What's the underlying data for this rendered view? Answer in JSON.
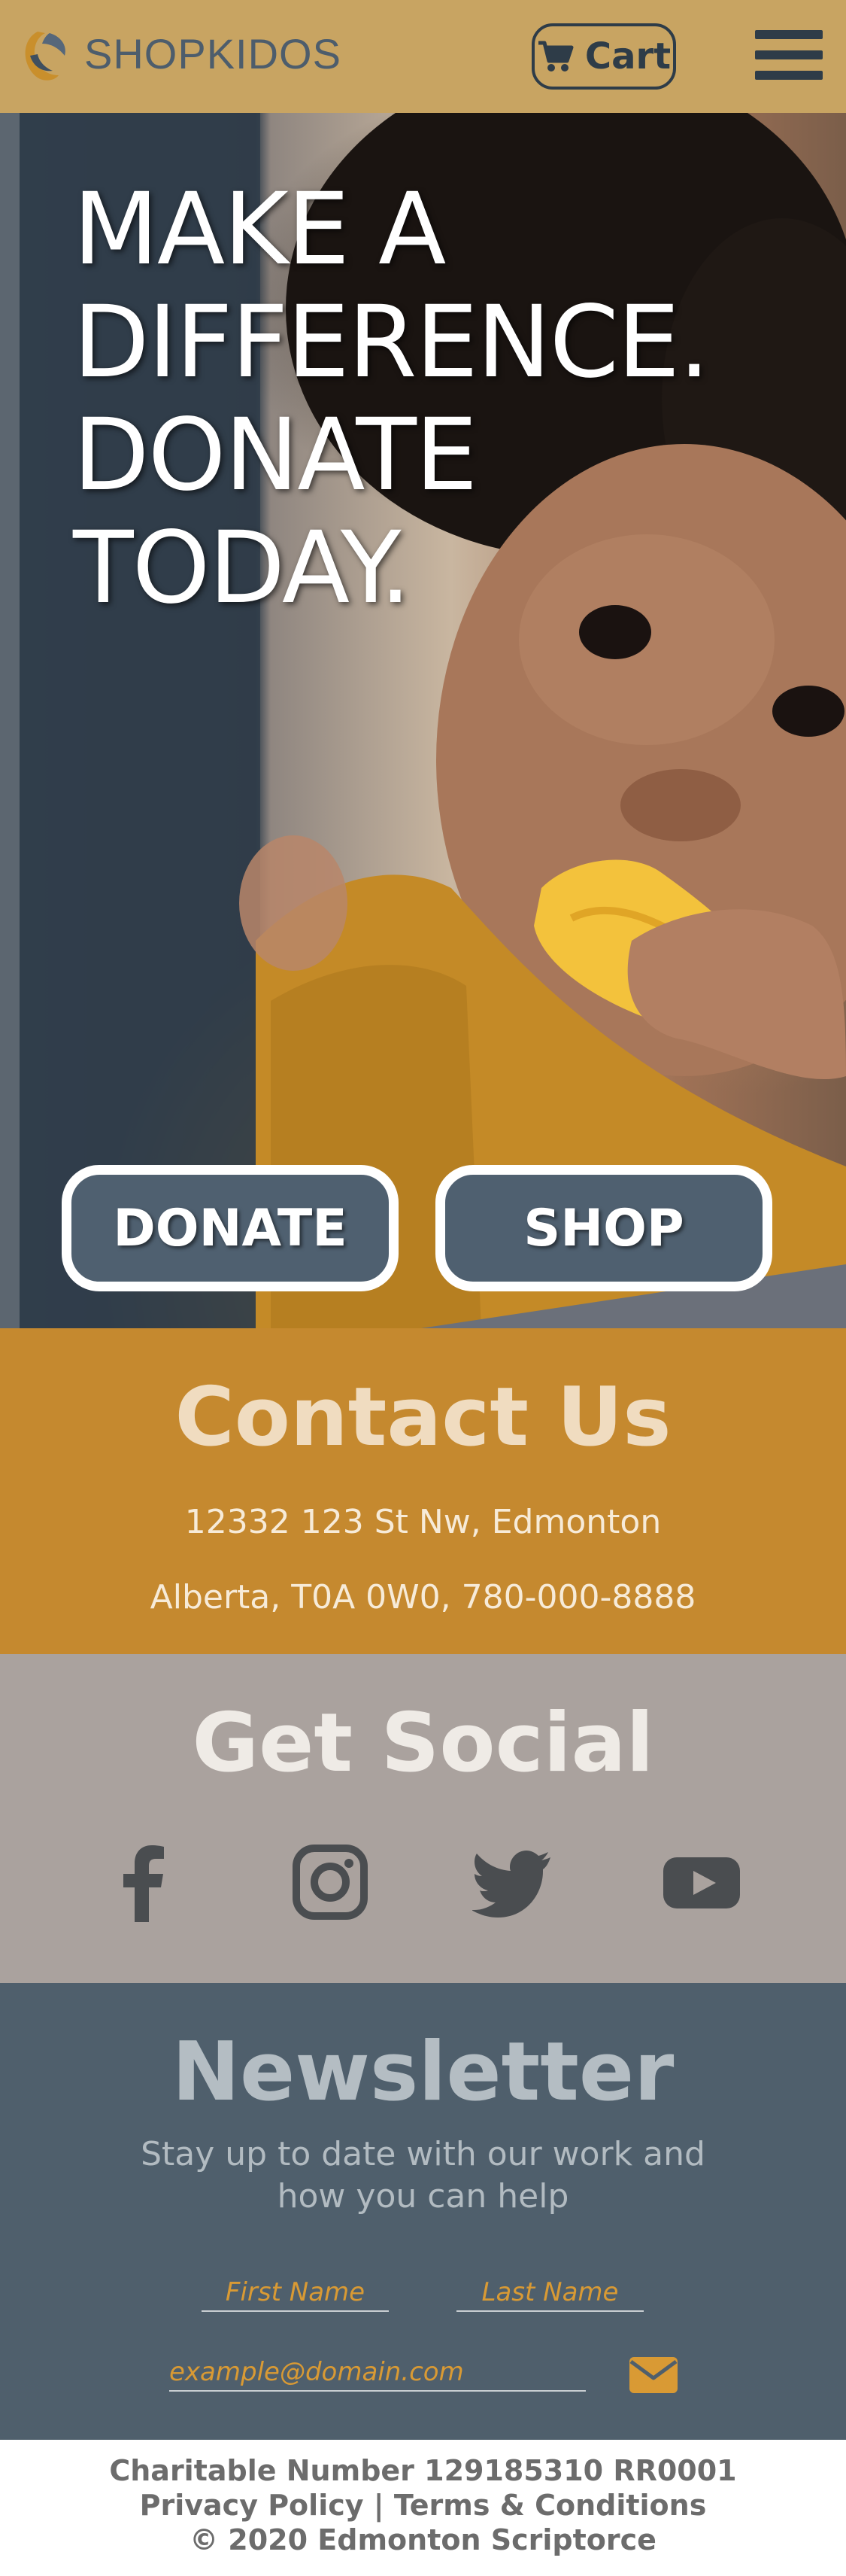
{
  "nav": {
    "brand": "SHOPKIDOS",
    "cart_label": "Cart",
    "cart_icon": "shopping-cart-icon",
    "menu_icon": "hamburger-menu-icon",
    "colors": {
      "bar": "#c6a05c",
      "brand_text": "#4d5d6c",
      "dark": "#2e3c48"
    }
  },
  "hero": {
    "title_lines": [
      "MAKE A",
      "DIFFERENCE.",
      "DONATE",
      "TODAY."
    ],
    "donate_label": "DONATE",
    "shop_label": "SHOP"
  },
  "contact": {
    "title": "Contact Us",
    "line1": "12332 123 St Nw, Edmonton",
    "line2": "Alberta, T0A 0W0, 780-000-8888",
    "color": "#c5892f"
  },
  "social": {
    "title": "Get Social",
    "icons": [
      "facebook-icon",
      "instagram-icon",
      "twitter-icon",
      "youtube-icon"
    ],
    "color": "#aaa29e"
  },
  "newsletter": {
    "title": "Newsletter",
    "description": "Stay up to date with our work and how you can help",
    "first_name_placeholder": "First Name",
    "last_name_placeholder": "Last Name",
    "email_placeholder": "example@domain.com",
    "submit_icon": "envelope-icon",
    "color": "#4f5f6c"
  },
  "footer": {
    "charitable": "Charitable Number 129185310 RR0001",
    "privacy": "Privacy Policy",
    "separator": "|",
    "terms": "Terms & Conditions",
    "copyright": "© 2020 Edmonton Scriptorce"
  }
}
